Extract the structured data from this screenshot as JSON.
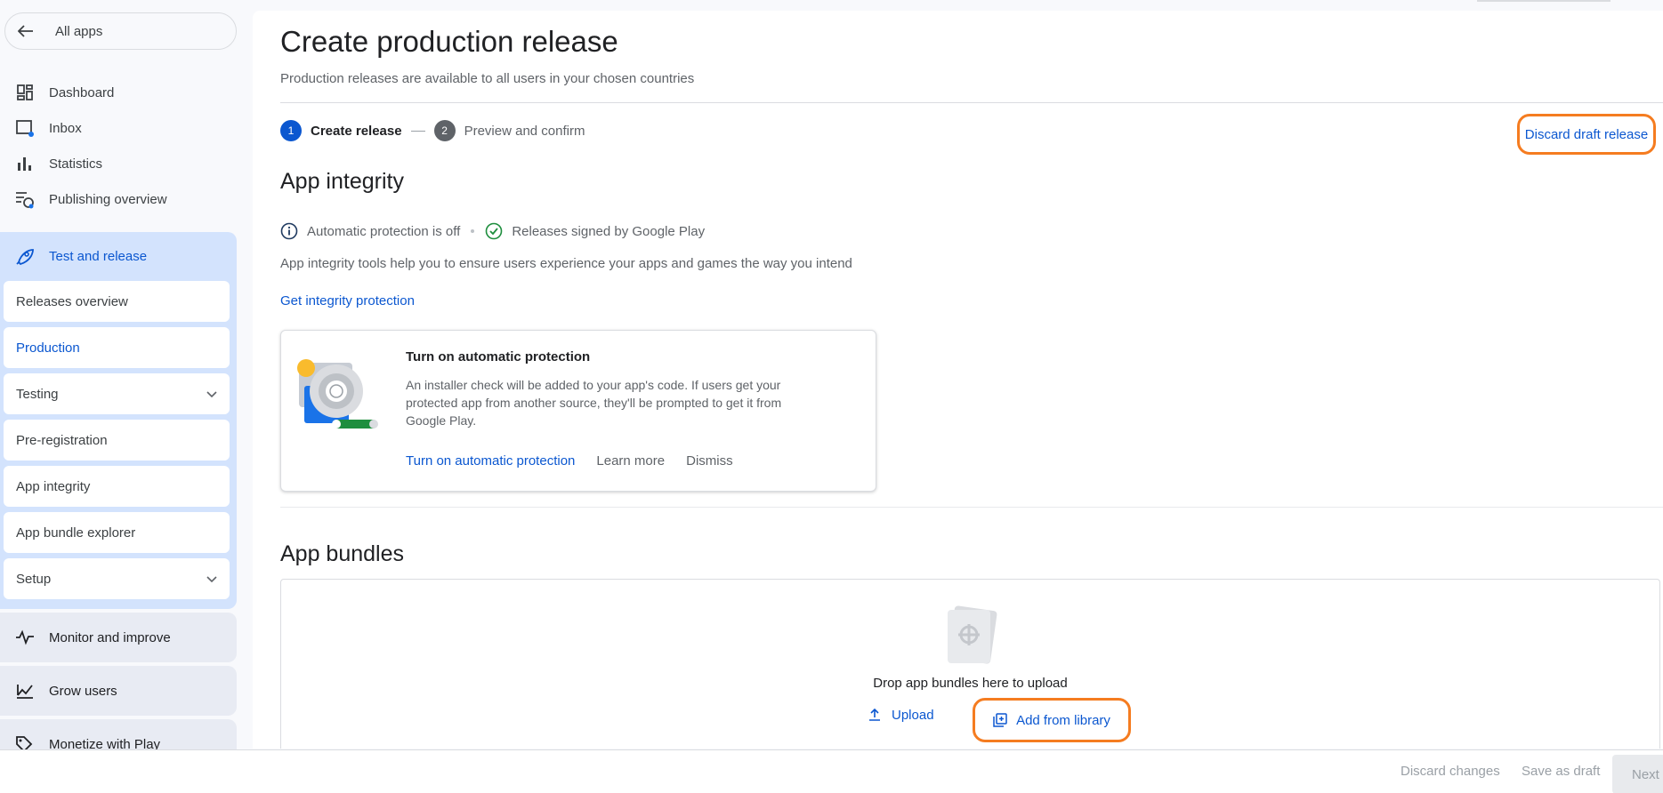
{
  "sidebar": {
    "all_apps": "All apps",
    "items": [
      {
        "label": "Dashboard",
        "icon": "dashboard-icon"
      },
      {
        "label": "Inbox",
        "icon": "inbox-icon"
      },
      {
        "label": "Statistics",
        "icon": "bar-chart-icon"
      },
      {
        "label": "Publishing overview",
        "icon": "publishing-overview-icon"
      }
    ],
    "active_section": {
      "label": "Test and release",
      "icon": "rocket-icon",
      "sub_items": [
        {
          "label": "Releases overview",
          "expandable": false
        },
        {
          "label": "Production",
          "expandable": false,
          "active": true
        },
        {
          "label": "Testing",
          "expandable": true
        },
        {
          "label": "Pre-registration",
          "expandable": false
        },
        {
          "label": "App integrity",
          "expandable": false
        },
        {
          "label": "App bundle explorer",
          "expandable": false
        },
        {
          "label": "Setup",
          "expandable": true
        }
      ]
    },
    "groups": [
      {
        "label": "Monitor and improve",
        "icon": "pulse-icon"
      },
      {
        "label": "Grow users",
        "icon": "grow-users-icon"
      },
      {
        "label": "Monetize with Play",
        "icon": "tag-icon"
      }
    ]
  },
  "main": {
    "title": "Create production release",
    "subtitle": "Production releases are available to all users in your chosen countries",
    "steps": [
      {
        "number": "1",
        "label": "Create release"
      },
      {
        "number": "2",
        "label": "Preview and confirm"
      }
    ],
    "discard_draft": "Discard draft release",
    "app_integrity": {
      "heading": "App integrity",
      "status_protection": "Automatic protection is off",
      "status_signing": "Releases signed by Google Play",
      "description": "App integrity tools help you to ensure users experience your apps and games the way you intend",
      "link": "Get integrity protection",
      "card": {
        "title": "Turn on automatic protection",
        "text": "An installer check will be added to your app's code. If users get your protected app from another source, they'll be prompted to get it from Google Play.",
        "action_primary": "Turn on automatic protection",
        "action_learn": "Learn more",
        "action_dismiss": "Dismiss"
      }
    },
    "app_bundles": {
      "heading": "App bundles",
      "drop_text": "Drop app bundles here to upload",
      "upload": "Upload",
      "add_from_library": "Add from library"
    }
  },
  "footer": {
    "discard_changes": "Discard changes",
    "save_as_draft": "Save as draft",
    "next": "Next"
  },
  "colors": {
    "accent": "#0b57d0",
    "highlight": "#f57c20",
    "active_section_bg": "#d3e3fd",
    "success": "#1e8e3e"
  }
}
